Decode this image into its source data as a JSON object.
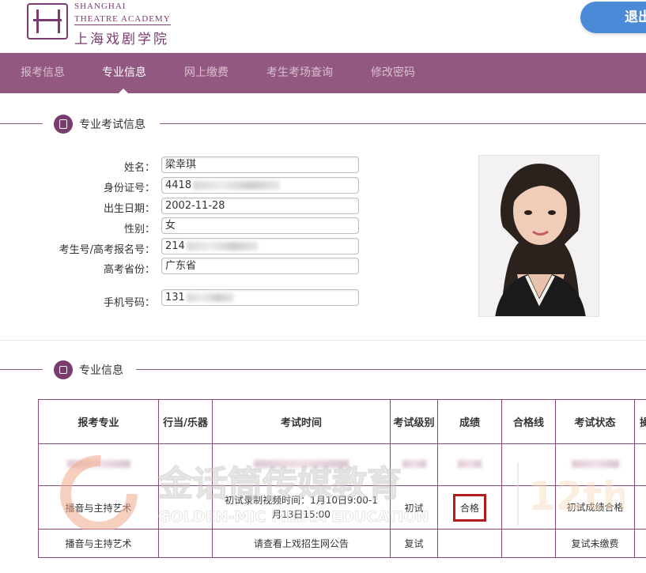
{
  "header": {
    "logo_en_line1": "SHANGHAI",
    "logo_en_line2": "THEATRE ACADEMY",
    "logo_cn": "上海戏剧学院",
    "logout_label": "退出"
  },
  "nav": {
    "items": [
      {
        "label": "报考信息"
      },
      {
        "label": "专业信息"
      },
      {
        "label": "网上缴费"
      },
      {
        "label": "考生考场查询"
      },
      {
        "label": "修改密码"
      }
    ],
    "active_index": 1
  },
  "exam_info": {
    "section_title": "专业考试信息",
    "fields": [
      {
        "label": "姓名：",
        "value": "梁幸琪"
      },
      {
        "label": "身份证号：",
        "value": "4418"
      },
      {
        "label": "出生日期：",
        "value": "2002-11-28"
      },
      {
        "label": "性别：",
        "value": "女"
      },
      {
        "label": "考生号/高考报名号：",
        "value": "214"
      },
      {
        "label": "高考省份：",
        "value": "广东省"
      },
      {
        "label": "手机号码：",
        "value": "131"
      }
    ]
  },
  "major_info": {
    "section_title": "专业信息",
    "headers": [
      "报考专业",
      "行当/乐器",
      "考试时间",
      "考试级别",
      "成绩",
      "合格线",
      "考试状态",
      "操"
    ],
    "rows": [
      {
        "major": "",
        "instrument": "",
        "time": "",
        "level": "",
        "score": "",
        "line": "",
        "status": ""
      },
      {
        "major": "播音与主持艺术",
        "instrument": "",
        "time": "初试录制视频时间：1月10日9:00-1月13日15:00",
        "level": "初试",
        "score": "合格",
        "line": "",
        "status": "初试成绩合格"
      },
      {
        "major": "播音与主持艺术",
        "instrument": "",
        "time": "请查看上戏招生网公告",
        "level": "复试",
        "score": "",
        "line": "",
        "status": "复试未缴费"
      }
    ]
  },
  "watermark": {
    "cn": "金话筒传媒教育",
    "en": "GOLDEN-MIC MEDIA EDUCATION",
    "badge": "12th"
  },
  "colors": {
    "brand": "#93587f",
    "logo": "#7a3b6e",
    "logout": "#4b8ad6",
    "highlight": "#b21d1d"
  }
}
